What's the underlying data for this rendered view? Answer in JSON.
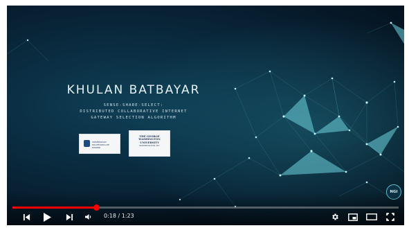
{
  "slide": {
    "name": "KHULAN BATBAYAR",
    "subtitle_lines": [
      "SENSE-SHARE-SELECT:",
      "DISTRIBUTED COLLABORATIVE INTERNET",
      "GATEWAY SELECTION ALGORITHM"
    ],
    "logos": {
      "left_text": "UNIVERSIDAD POLITÉCNICA DE MADRID",
      "right_text": [
        "THE GEORGE",
        "WASHINGTON",
        "UNIVERSITY",
        "WASHINGTON, DC"
      ]
    },
    "badge": "NGI"
  },
  "player": {
    "current_time": "0:18",
    "separator": "/",
    "duration": "1:23",
    "progress_fraction": 0.217,
    "accent_color": "#ff0000",
    "icons": [
      "skip-previous-icon",
      "play-icon",
      "skip-next-icon",
      "volume-icon",
      "settings-gear-icon",
      "miniplayer-icon",
      "theater-mode-icon",
      "fullscreen-icon"
    ]
  }
}
